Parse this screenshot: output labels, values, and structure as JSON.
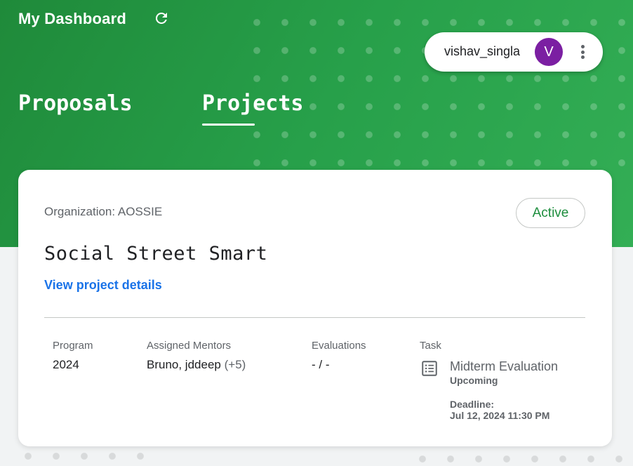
{
  "header": {
    "title": "My Dashboard",
    "refresh_icon": "refresh-icon",
    "user": {
      "name": "vishav_singla",
      "avatar_initial": "V",
      "avatar_color": "#7b1fa2",
      "menu_icon": "more-vert-icon"
    }
  },
  "tabs": [
    {
      "label": "Proposals",
      "active": false
    },
    {
      "label": "Projects",
      "active": true
    }
  ],
  "project_card": {
    "organization": "Organization: AOSSIE",
    "status": "Active",
    "project_name": "Social Street Smart",
    "view_link": "View project details",
    "fields": {
      "program": {
        "label": "Program",
        "value": "2024"
      },
      "mentors": {
        "label": "Assigned Mentors",
        "value": "Bruno, jddeep",
        "extra": "(+5)"
      },
      "evaluations": {
        "label": "Evaluations",
        "value": "- / -"
      },
      "task": {
        "label": "Task",
        "icon": "list-icon",
        "title": "Midterm Evaluation",
        "state": "Upcoming",
        "deadline_label": "Deadline:",
        "deadline_value": "Jul 12, 2024 11:30 PM"
      }
    }
  },
  "colors": {
    "hero_green": "#27a04a",
    "status_green": "#1e8e3e",
    "link_blue": "#1a73e8"
  }
}
